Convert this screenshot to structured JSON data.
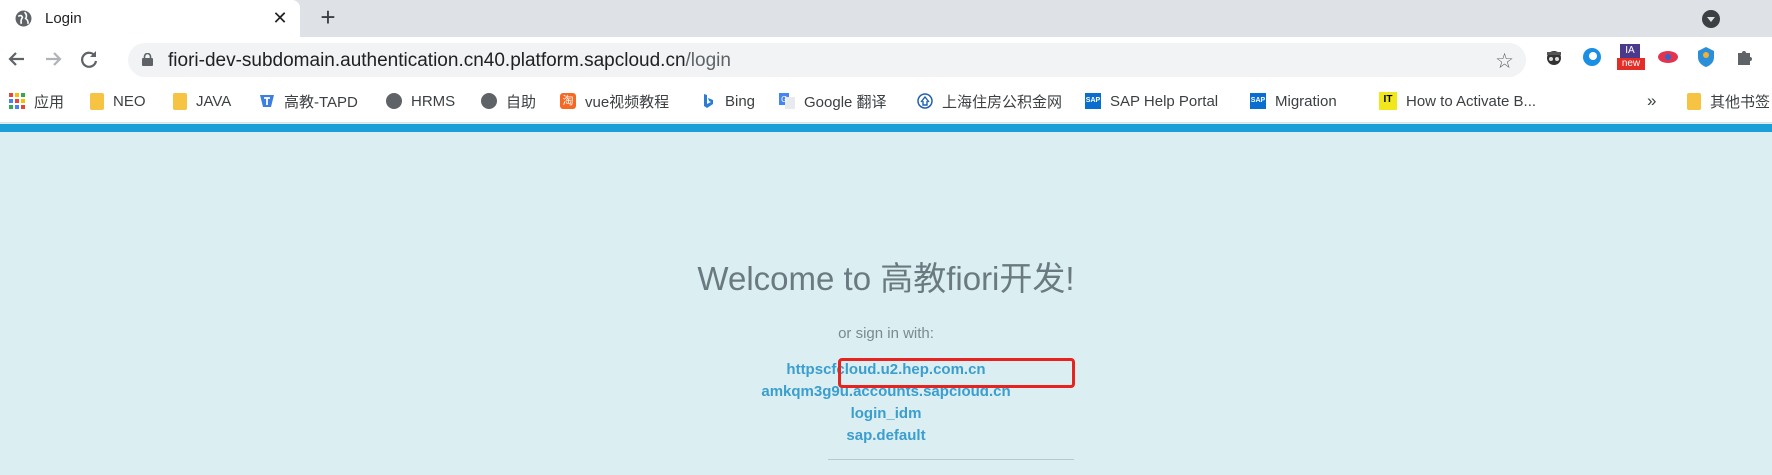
{
  "browser": {
    "tab": {
      "title": "Login",
      "close_icon": "✕"
    },
    "new_tab_icon": "+",
    "url_host": "fiori-dev-subdomain.authentication.cn40.platform.sapcloud.cn",
    "url_path": "/login"
  },
  "bookmarks": [
    {
      "label": "应用",
      "icon": "apps-grid-icon"
    },
    {
      "label": "NEO",
      "icon": "folder-icon"
    },
    {
      "label": "JAVA",
      "icon": "folder-icon"
    },
    {
      "label": "高教-TAPD",
      "icon": "tapd-icon"
    },
    {
      "label": "HRMS",
      "icon": "globe-icon"
    },
    {
      "label": "自助",
      "icon": "globe-icon"
    },
    {
      "label": "vue视频教程",
      "icon": "video-icon"
    },
    {
      "label": "Bing",
      "icon": "bing-icon"
    },
    {
      "label": "Google 翻译",
      "icon": "translate-icon"
    },
    {
      "label": "上海住房公积金网",
      "icon": "housing-fund-icon"
    },
    {
      "label": "SAP Help Portal",
      "icon": "sap-icon"
    },
    {
      "label": "Migration",
      "icon": "sap-icon"
    },
    {
      "label": "How to Activate B...",
      "icon": "it-icon"
    },
    {
      "label": "»",
      "icon": ""
    },
    {
      "label": "其他书签",
      "icon": "folder-icon"
    }
  ],
  "extensions": {
    "new_badge": "new"
  },
  "login": {
    "welcome": "Welcome to 高教fiori开发!",
    "or_sign_in": "or sign in with:",
    "providers": [
      "httpscfcloud.u2.hep.com.cn",
      "amkqm3g9u.accounts.sapcloud.cn",
      "login_idm",
      "sap.default"
    ]
  },
  "colors": {
    "accent_bar": "#1a9fd8",
    "page_bg": "#dbeef1",
    "link": "#3a9ecf",
    "highlight": "#e8231f"
  }
}
